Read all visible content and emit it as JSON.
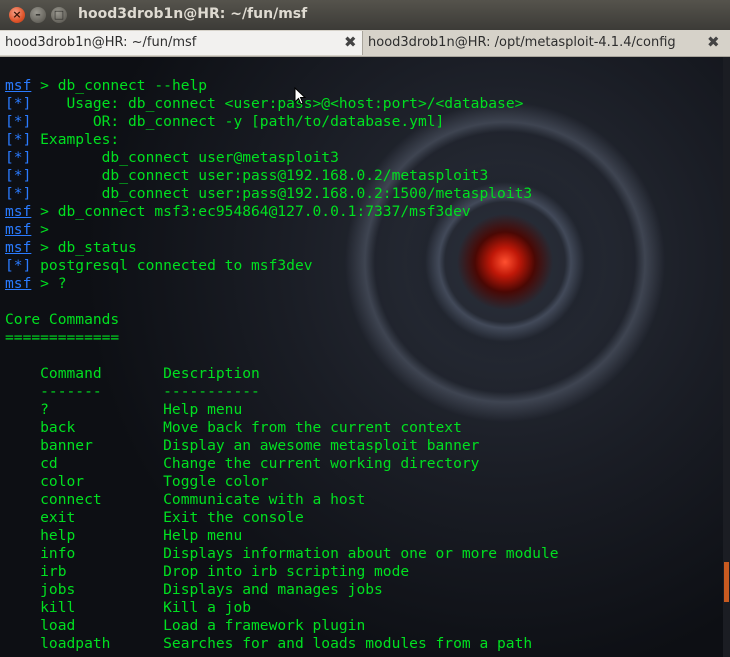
{
  "window": {
    "title": "hood3drob1n@HR: ~/fun/msf",
    "close_glyph": "×",
    "min_glyph": "–",
    "max_glyph": "□"
  },
  "tabs": [
    {
      "label": "hood3drob1n@HR: ~/fun/msf",
      "close_glyph": "✖",
      "active": true
    },
    {
      "label": "hood3drob1n@HR: /opt/metasploit-4.1.4/config",
      "close_glyph": "✖",
      "active": false
    }
  ],
  "terminal": {
    "prompt": "msf",
    "status_marker": "[*]",
    "colors": {
      "text": "#00e020",
      "prompt": "#2a7bff",
      "marker": "#2a7bff"
    },
    "lines": [
      {
        "prompt": "msf",
        "text": " > db_connect --help"
      },
      {
        "marker": "[*]",
        "text": "    Usage: db_connect <user:pass>@<host:port>/<database>"
      },
      {
        "marker": "[*]",
        "text": "       OR: db_connect -y [path/to/database.yml]"
      },
      {
        "marker": "[*]",
        "text": " Examples:"
      },
      {
        "marker": "[*]",
        "text": "        db_connect user@metasploit3"
      },
      {
        "marker": "[*]",
        "text": "        db_connect user:pass@192.168.0.2/metasploit3"
      },
      {
        "marker": "[*]",
        "text": "        db_connect user:pass@192.168.0.2:1500/metasploit3"
      },
      {
        "prompt": "msf",
        "text": " > db_connect msf3:ec954864@127.0.0.1:7337/msf3dev"
      },
      {
        "prompt": "msf",
        "text": " >"
      },
      {
        "prompt": "msf",
        "text": " > db_status"
      },
      {
        "marker": "[*]",
        "text": " postgresql connected to msf3dev"
      },
      {
        "prompt": "msf",
        "text": " > ?"
      },
      {
        "text": ""
      },
      {
        "text": "Core Commands"
      },
      {
        "text": "============="
      },
      {
        "text": ""
      },
      {
        "text": "    Command       Description"
      },
      {
        "text": "    -------       -----------"
      },
      {
        "text": "    ?             Help menu"
      },
      {
        "text": "    back          Move back from the current context"
      },
      {
        "text": "    banner        Display an awesome metasploit banner"
      },
      {
        "text": "    cd            Change the current working directory"
      },
      {
        "text": "    color         Toggle color"
      },
      {
        "text": "    connect       Communicate with a host"
      },
      {
        "text": "    exit          Exit the console"
      },
      {
        "text": "    help          Help menu"
      },
      {
        "text": "    info          Displays information about one or more module"
      },
      {
        "text": "    irb           Drop into irb scripting mode"
      },
      {
        "text": "    jobs          Displays and manages jobs"
      },
      {
        "text": "    kill          Kill a job"
      },
      {
        "text": "    load          Load a framework plugin"
      },
      {
        "text": "    loadpath      Searches for and loads modules from a path"
      }
    ]
  }
}
